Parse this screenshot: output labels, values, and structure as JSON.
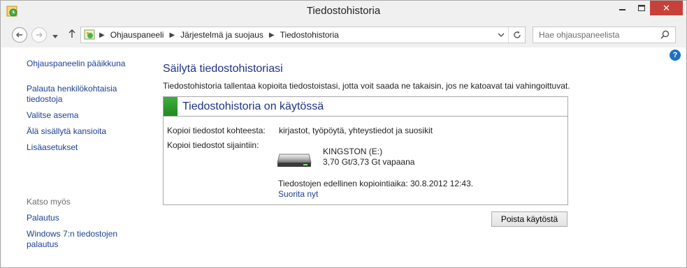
{
  "window": {
    "title": "Tiedostohistoria",
    "close_glyph": "✕",
    "minimize_icon": "minimize-icon",
    "maximize_icon": "maximize-icon"
  },
  "address": {
    "breadcrumbs": [
      "Ohjauspaneeli",
      "Järjestelmä ja suojaus",
      "Tiedostohistoria"
    ],
    "separator": "▶"
  },
  "search": {
    "placeholder": "Hae ohjauspaneelista"
  },
  "sidebar": {
    "items": [
      {
        "label": "Ohjauspaneelin pääikkuna"
      },
      {
        "label": "Palauta henkilökohtaisia tiedostoja"
      },
      {
        "label": "Valitse asema"
      },
      {
        "label": "Älä sisällytä kansioita"
      },
      {
        "label": "Lisäasetukset"
      }
    ],
    "see_also_title": "Katso myös",
    "see_also": [
      {
        "label": "Palautus"
      },
      {
        "label": "Windows 7:n tiedostojen palautus"
      }
    ]
  },
  "main": {
    "heading": "Säilytä tiedostohistoriasi",
    "description": "Tiedostohistoria tallentaa kopioita tiedostoistasi, jotta voit saada ne takaisin, jos ne katoavat tai vahingoittuvat.",
    "status_title": "Tiedostohistoria on käytössä",
    "status_color": "#2f9e2f",
    "copy_target_label": "Kopioi tiedostot kohteesta:",
    "copy_target_value": "kirjastot, työpöytä, yhteystiedot ja suosikit",
    "copy_dest_label": "Kopioi tiedostot sijaintiin:",
    "drive_name": "KINGSTON (E:)",
    "drive_space": "3,70 Gt/3,73 Gt vapaana",
    "last_copy": "Tiedostojen edellinen kopiointiaika: 30.8.2012 12:43.",
    "run_now": "Suorita nyt",
    "disable_button": "Poista käytöstä"
  },
  "colors": {
    "link": "#1c3f94",
    "heading": "#1e3287",
    "close_button": "#c7413a"
  }
}
